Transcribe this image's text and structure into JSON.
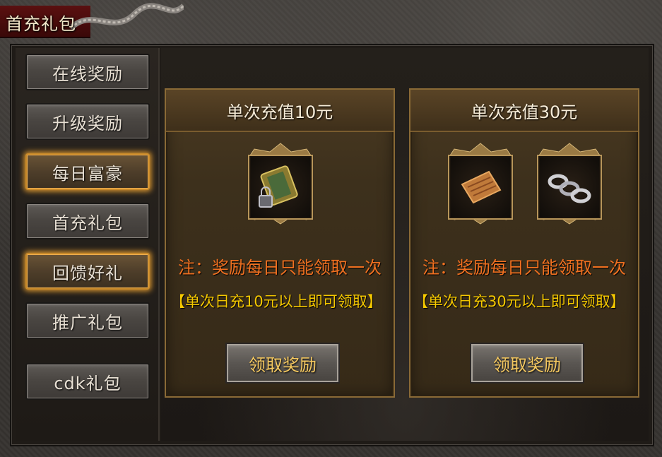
{
  "window": {
    "title": "首充礼包"
  },
  "sidebar": {
    "items": [
      {
        "label": "在线奖励",
        "highlighted": false
      },
      {
        "label": "升级奖励",
        "highlighted": false
      },
      {
        "label": "每日富豪",
        "highlighted": true
      },
      {
        "label": "首充礼包",
        "highlighted": false
      },
      {
        "label": "回馈好礼",
        "highlighted": true
      },
      {
        "label": "推广礼包",
        "highlighted": false
      },
      {
        "label": "cdk礼包",
        "highlighted": false
      }
    ]
  },
  "cards": [
    {
      "title": "单次充值10元",
      "items": [
        {
          "icon": "locked-scroll-icon"
        }
      ],
      "note": "注：奖励每日只能领取一次",
      "condition": "【单次日充10元以上即可领取】",
      "button_label": "领取奖励"
    },
    {
      "title": "单次充值30元",
      "items": [
        {
          "icon": "parchment-icon"
        },
        {
          "icon": "silver-chain-icon"
        }
      ],
      "note": "注：奖励每日只能领取一次",
      "condition": "【单次日充30元以上即可领取】",
      "button_label": "领取奖励"
    }
  ],
  "colors": {
    "note": "#f07020",
    "condition": "#f5c800",
    "button_text": "#f4c860",
    "glow": "#e09a30"
  }
}
